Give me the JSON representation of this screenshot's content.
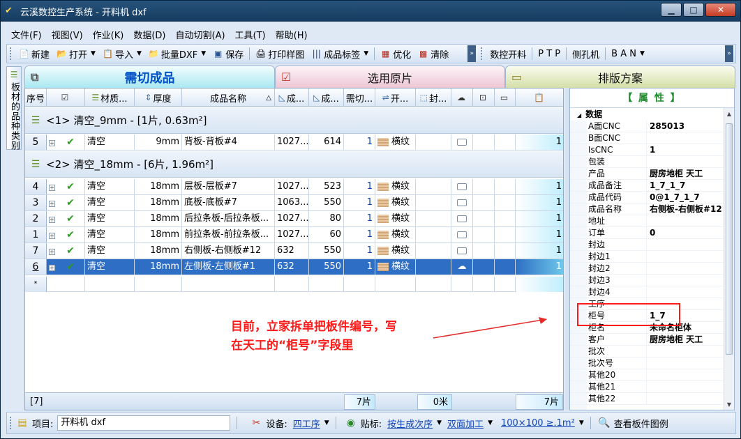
{
  "window": {
    "title": "云溪数控生产系统 - 开料机 dxf"
  },
  "menu": [
    "文件(F)",
    "视图(V)",
    "作业(K)",
    "数据(D)",
    "自动切割(A)",
    "工具(T)",
    "帮助(H)"
  ],
  "toolbar": {
    "new": "新建",
    "open": "打开",
    "import": "导入",
    "batch_dxf": "批量DXF",
    "save": "保存",
    "print_sample": "打印样图",
    "product_label": "成品标签",
    "optimize": "优化",
    "clear": "清除",
    "cnc_cut": "数控开料",
    "ptp": "P T P",
    "side_drill": "侧孔机",
    "ban": "B A N"
  },
  "side_tab": {
    "label": "板材的品种类别"
  },
  "tabs": [
    {
      "label": "需切成品"
    },
    {
      "label": "选用原片"
    },
    {
      "label": "排版方案"
    }
  ],
  "grid": {
    "headers": [
      "序号",
      "",
      "材质...",
      "厚度",
      "成品名称",
      "成...",
      "成...",
      "需切...",
      "开...",
      "封...",
      "",
      "",
      "",
      ""
    ],
    "sort_glyph": "△",
    "groups": [
      {
        "label": "<1> 清空_9mm - [1片, 0.63m²]"
      },
      {
        "label": "<2> 清空_18mm - [6片, 1.96m²]"
      }
    ],
    "rows": [
      {
        "seq": "5",
        "material": "清空",
        "thickness": "9mm",
        "name": "背板-背板#4",
        "length": "1027....",
        "width": "614",
        "qty": "1",
        "grain": "横纹",
        "count": "1"
      },
      {
        "seq": "4",
        "material": "清空",
        "thickness": "18mm",
        "name": "层板-层板#7",
        "length": "1027....",
        "width": "523",
        "qty": "1",
        "grain": "横纹",
        "count": "1"
      },
      {
        "seq": "3",
        "material": "清空",
        "thickness": "18mm",
        "name": "底板-底板#7",
        "length": "1063....",
        "width": "550",
        "qty": "1",
        "grain": "横纹",
        "count": "1"
      },
      {
        "seq": "2",
        "material": "清空",
        "thickness": "18mm",
        "name": "后拉条板-后拉条板...",
        "length": "1027....",
        "width": "80",
        "qty": "1",
        "grain": "横纹",
        "count": "1"
      },
      {
        "seq": "1",
        "material": "清空",
        "thickness": "18mm",
        "name": "前拉条板-前拉条板...",
        "length": "1027....",
        "width": "60",
        "qty": "1",
        "grain": "横纹",
        "count": "1"
      },
      {
        "seq": "7",
        "material": "清空",
        "thickness": "18mm",
        "name": "右侧板-右侧板#12",
        "length": "632",
        "width": "550",
        "qty": "1",
        "grain": "横纹",
        "count": "1"
      },
      {
        "seq": "6",
        "material": "清空",
        "thickness": "18mm",
        "name": "左侧板-左侧板#1",
        "length": "632",
        "width": "550",
        "qty": "1",
        "grain": "横纹",
        "count": "1"
      }
    ],
    "new_row_marker": "*",
    "footer": {
      "count": "[7]",
      "pieces": "7片",
      "meters": "0米",
      "total": "7片"
    }
  },
  "annotation": {
    "line1": "目前，立家拆单把板件编号，写",
    "line2": "在天工的“柜号”字段里"
  },
  "properties": {
    "title": "【 属 性 】",
    "category": "数据",
    "items": [
      {
        "name": "A面CNC",
        "value": "285013"
      },
      {
        "name": "B面CNC",
        "value": ""
      },
      {
        "name": "IsCNC",
        "value": "1"
      },
      {
        "name": "包装",
        "value": ""
      },
      {
        "name": "产品",
        "value": "厨房地柜 天工"
      },
      {
        "name": "成品备注",
        "value": "1_7_1_7"
      },
      {
        "name": "成品代码",
        "value": "0@1_7_1_7"
      },
      {
        "name": "成品名称",
        "value": "右侧板-右侧板#12"
      },
      {
        "name": "地址",
        "value": ""
      },
      {
        "name": "订单",
        "value": "0"
      },
      {
        "name": "封边",
        "value": ""
      },
      {
        "name": "封边1",
        "value": ""
      },
      {
        "name": "封边2",
        "value": ""
      },
      {
        "name": "封边3",
        "value": ""
      },
      {
        "name": "封边4",
        "value": ""
      },
      {
        "name": "工序",
        "value": ""
      },
      {
        "name": "柜号",
        "value": "1_7"
      },
      {
        "name": "柜名",
        "value": "未命名柜体"
      },
      {
        "name": "客户",
        "value": "厨房地柜 天工"
      },
      {
        "name": "批次",
        "value": ""
      },
      {
        "name": "批次号",
        "value": ""
      },
      {
        "name": "其他20",
        "value": ""
      },
      {
        "name": "其他21",
        "value": ""
      },
      {
        "name": "其他22",
        "value": ""
      }
    ]
  },
  "statusbar": {
    "project_label": "项目:",
    "project_value": "开料机 dxf",
    "device_label": "设备:",
    "device_value": "四工序",
    "label_label": "贴标:",
    "label_value1": "按生成次序",
    "label_value2": "双面加工",
    "size_value": "100×100 ≥.1m²",
    "view_pattern": "查看板件图例"
  }
}
